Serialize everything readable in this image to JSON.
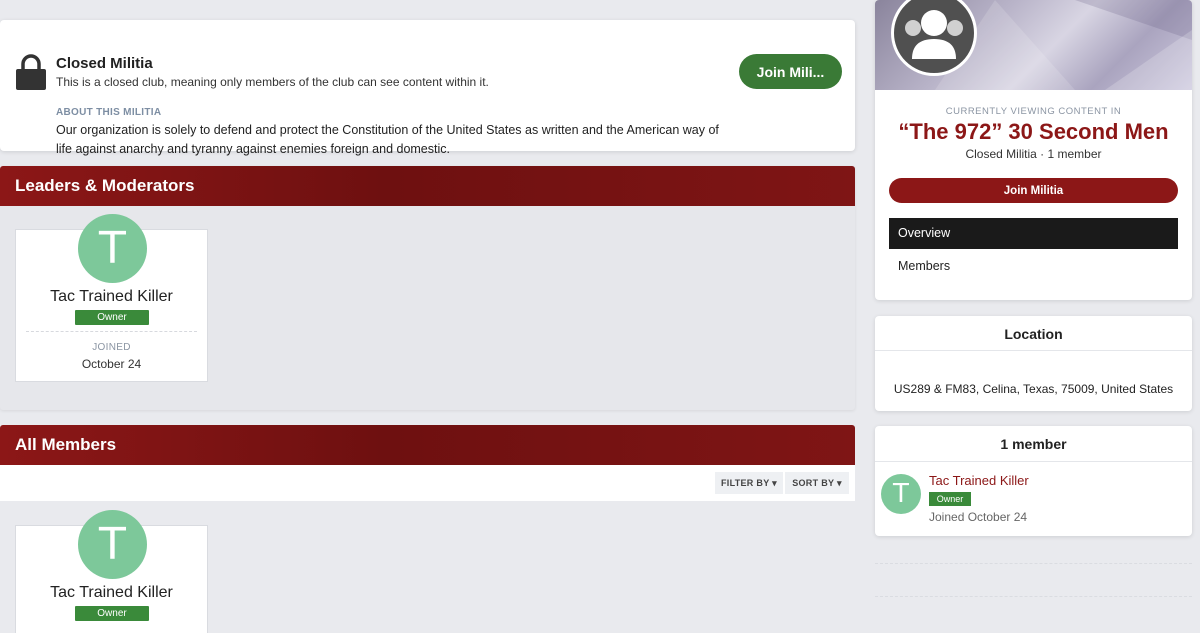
{
  "closed_banner": {
    "title": "Closed Militia",
    "description": "This is a closed club, meaning only members of the club can see content within it.",
    "join_label": "Join Mili...",
    "about_label": "ABOUT THIS MILITIA",
    "about_text": "Our organization is solely to defend and protect the Constitution of the United States as written and the American way of life against anarchy and tyranny against enemies foreign and domestic."
  },
  "leaders": {
    "header": "Leaders & Moderators",
    "tiles": [
      {
        "initial": "T",
        "name": "Tac Trained Killer",
        "badge": "Owner",
        "joined_label": "JOINED",
        "joined_date": "October 24"
      }
    ]
  },
  "all_members": {
    "header": "All Members",
    "filter_label": "FILTER BY",
    "sort_label": "SORT BY",
    "tiles": [
      {
        "initial": "T",
        "name": "Tac Trained Killer",
        "badge": "Owner"
      }
    ]
  },
  "sidebar": {
    "viewing_label": "CURRENTLY VIEWING CONTENT IN",
    "club_name": "“The 972” 30 Second Men",
    "club_meta": "Closed Militia  ·  1 member",
    "join_label": "Join Militia",
    "nav": [
      {
        "label": "Overview",
        "active": true
      },
      {
        "label": "Members",
        "active": false
      }
    ],
    "location": {
      "title": "Location",
      "address": "US289 & FM83, Celina, Texas, 75009, United States"
    },
    "member_count": {
      "title": "1 member",
      "member": {
        "initial": "T",
        "name": "Tac Trained Killer",
        "badge": "Owner",
        "joined": "Joined October 24"
      }
    }
  },
  "colors": {
    "accent_red": "#8c1717",
    "join_green": "#3a7a36",
    "avatar_green": "#7dc89a",
    "owner_badge": "#3a8a3a"
  },
  "icons": {
    "lock": "lock-icon",
    "dropdown": "caret-down-icon",
    "club_avatar": "group-icon"
  }
}
